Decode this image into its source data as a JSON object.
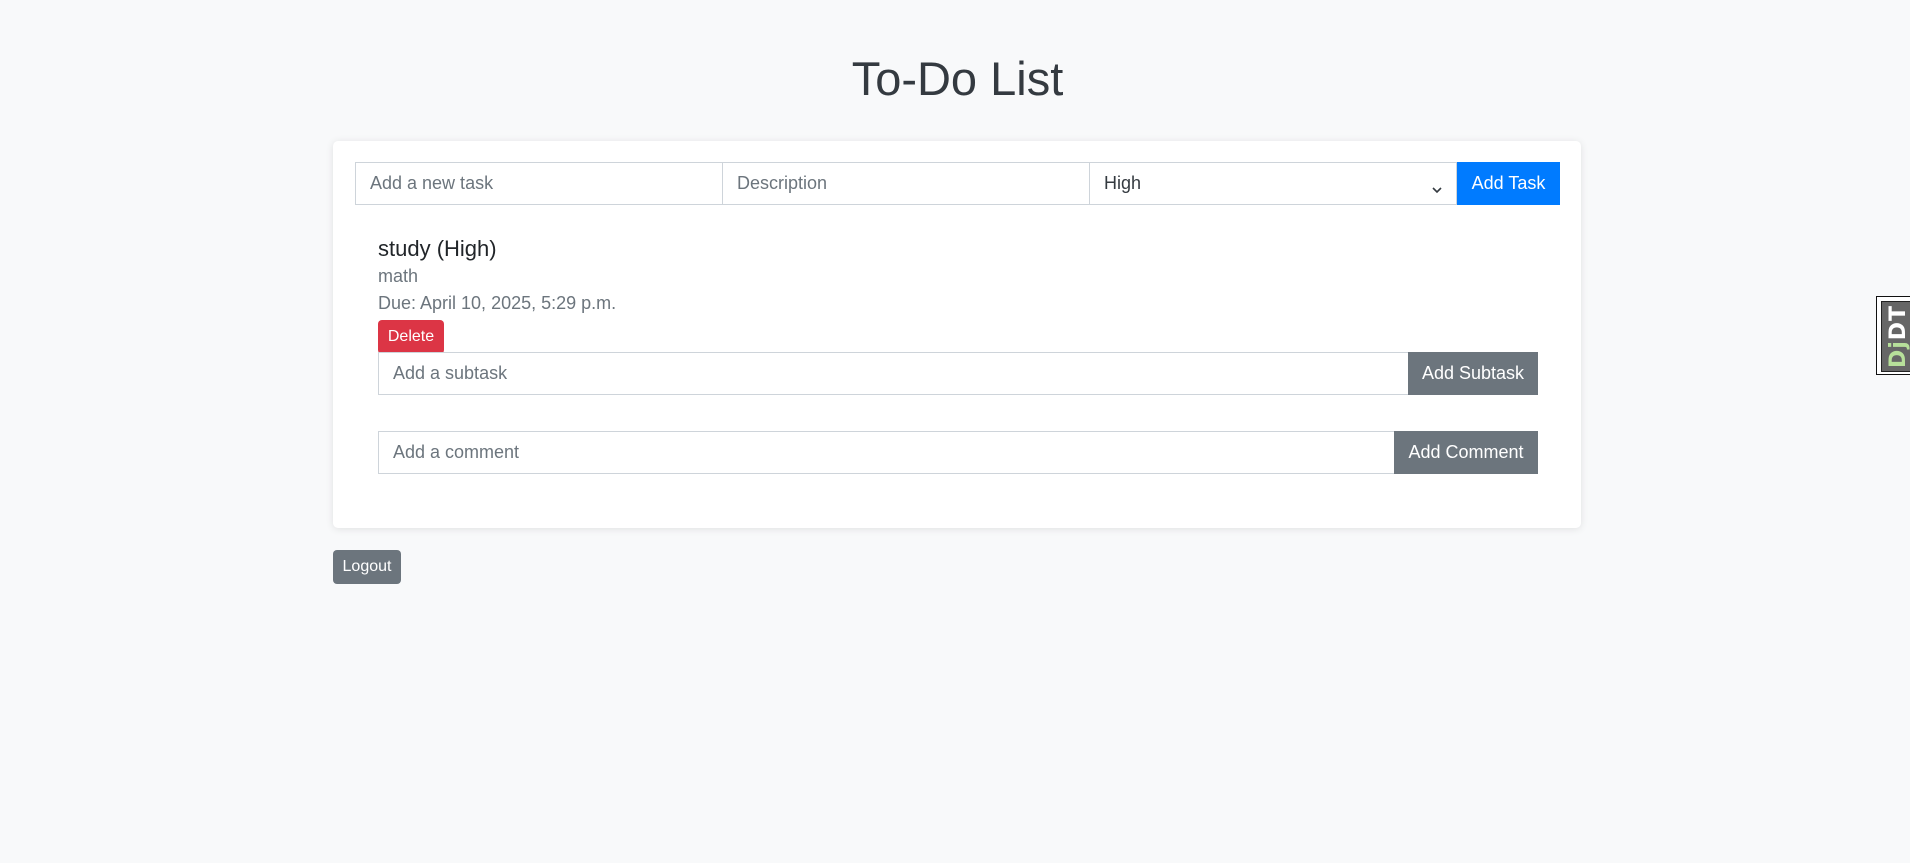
{
  "header": {
    "title": "To-Do List"
  },
  "add_task_form": {
    "title_placeholder": "Add a new task",
    "description_placeholder": "Description",
    "priority_selected": "High",
    "add_button_label": "Add Task"
  },
  "tasks": [
    {
      "heading": "study (High)",
      "description": "math",
      "due": "Due: April 10, 2025, 5:29 p.m.",
      "delete_label": "Delete",
      "subtask_placeholder": "Add a subtask",
      "subtask_button_label": "Add Subtask",
      "comment_placeholder": "Add a comment",
      "comment_button_label": "Add Comment"
    }
  ],
  "footer": {
    "logout_label": "Logout"
  },
  "debug_toolbar": {
    "label_prefix": "Dj",
    "label_suffix": "DT"
  },
  "colors": {
    "primary": "#007bff",
    "danger": "#dc3545",
    "secondary": "#6c757d",
    "background": "#f8f9fa"
  }
}
